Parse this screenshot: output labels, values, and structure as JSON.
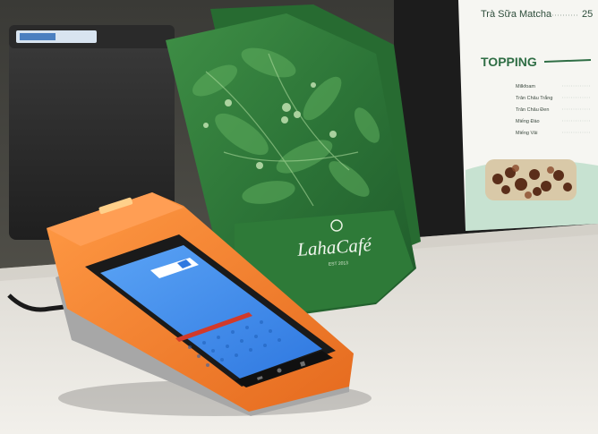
{
  "photo": {
    "subject": "Handheld POS terminal next to a LahaCafé coffee bag and a printed drink menu",
    "colors": {
      "terminal_body": "#f07a2a",
      "terminal_screen": "#3f8df0",
      "bag_green": "#2f7a3a",
      "counter": "#e9e6df",
      "menu_card": "#f7f7f4",
      "menu_heading": "#2f6e45"
    }
  },
  "menu_card": {
    "top_item": "Trà Sữa Matcha",
    "top_item_price": "25",
    "section_title": "TOPPING",
    "items": [
      "Milkfoam",
      "Trân Châu Trắng",
      "Trân Châu Đen",
      "Miếng Đào",
      "Miếng Vải"
    ]
  },
  "coffee_bag": {
    "brand": "LahaCafé",
    "tagline": "EST 2013"
  }
}
